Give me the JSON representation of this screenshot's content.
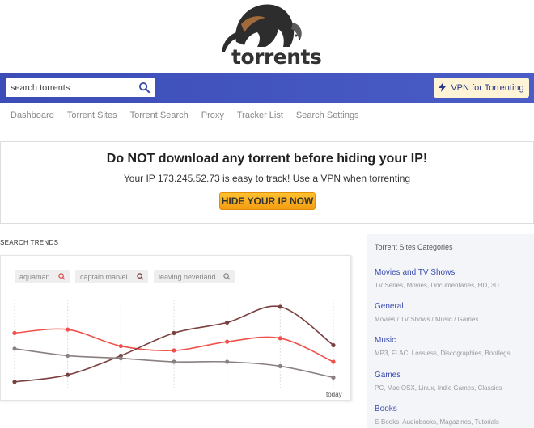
{
  "logo": {
    "text": "torrents"
  },
  "header": {
    "search_placeholder": "search torrents",
    "vpn_label": "VPN for Torrenting",
    "colors": {
      "bar": "#4354c0",
      "vpn_bg": "#fff4d6"
    }
  },
  "nav": {
    "items": [
      {
        "label": "Dashboard"
      },
      {
        "label": "Torrent Sites"
      },
      {
        "label": "Torrent Search"
      },
      {
        "label": "Proxy"
      },
      {
        "label": "Tracker List"
      },
      {
        "label": "Search Settings"
      }
    ]
  },
  "warning": {
    "title": "Do NOT download any torrent before hiding your IP!",
    "subtitle": "Your IP 173.245.52.73 is easy to track! Use a VPN when torrenting",
    "button": "HIDE YOUR IP NOW"
  },
  "trends": {
    "title": "SEARCH TRENDS",
    "chips": [
      {
        "label": "aquaman",
        "icon": "search-icon",
        "icon_color": "#e05050"
      },
      {
        "label": "captain marvel",
        "icon": "search-icon",
        "icon_color": "#7a3a3a"
      },
      {
        "label": "leaving neverland",
        "icon": "search-icon",
        "icon_color": "#888888"
      }
    ],
    "today_label": "today"
  },
  "chart_data": {
    "type": "line",
    "x": [
      1,
      2,
      3,
      4,
      5,
      6,
      7
    ],
    "xlabel": "",
    "ylabel": "",
    "ylim": [
      0,
      100
    ],
    "grid": "vertical",
    "series": [
      {
        "name": "aquaman",
        "color": "#f0504a",
        "values": [
          58,
          62,
          43,
          38,
          48,
          52,
          25
        ]
      },
      {
        "name": "captain marvel",
        "color": "#7a4040",
        "values": [
          2,
          10,
          32,
          58,
          70,
          88,
          44
        ]
      },
      {
        "name": "leaving neverland",
        "color": "#8a8080",
        "values": [
          40,
          32,
          29,
          25,
          25,
          20,
          7
        ]
      }
    ]
  },
  "sidebar": {
    "title": "Torrent Sites Categories",
    "categories": [
      {
        "name": "Movies and TV Shows",
        "desc": "TV Series, Movies, Documentaries, HD, 3D"
      },
      {
        "name": "General",
        "desc": "Movies / TV Shows / Music / Games"
      },
      {
        "name": "Music",
        "desc": "MP3, FLAC, Lossless, Discographies, Bootlegs"
      },
      {
        "name": "Games",
        "desc": "PC, Mac OSX, Linux, Indie Games, Classics"
      },
      {
        "name": "Books",
        "desc": "E-Books, Audiobooks, Magazines, Tutorials"
      }
    ]
  }
}
